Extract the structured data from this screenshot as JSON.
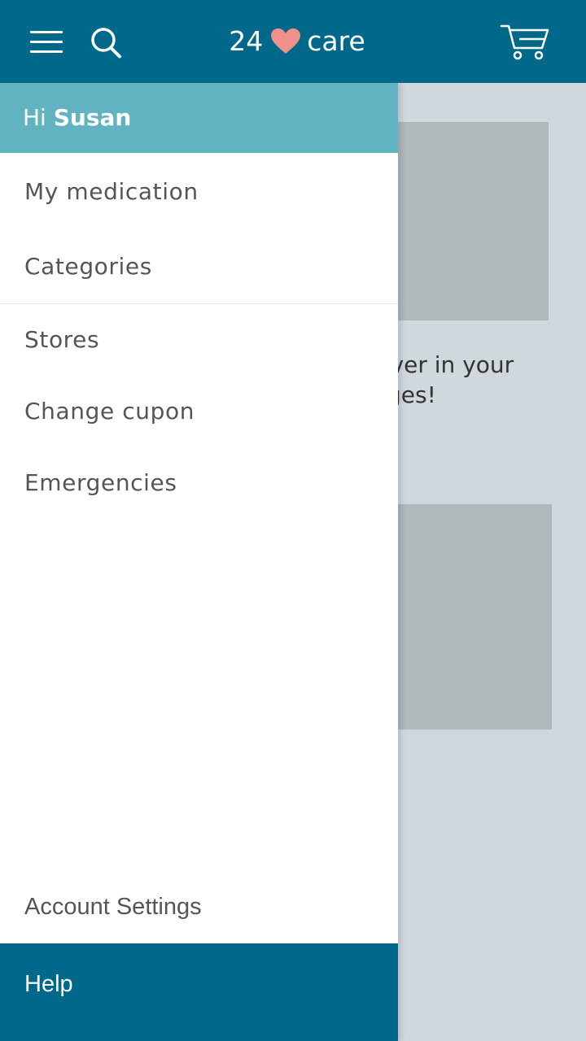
{
  "app": {
    "logo_number": "24",
    "logo_word": "care",
    "logo_heart_color": "#f0908a"
  },
  "colors": {
    "app_bar": "#00688b",
    "drawer_header": "#61b3c2",
    "help_bar": "#00688b",
    "background": "#cfd8dc"
  },
  "toolbar": {
    "menu_icon": "hamburger-menu-icon",
    "search_icon": "search-icon",
    "cart_icon": "shopping-cart-icon"
  },
  "drawer": {
    "greeting": "Hi",
    "user_name": "Susan",
    "items": [
      {
        "label": "My medication"
      },
      {
        "label": "Categories"
      },
      {
        "label": "Stores"
      },
      {
        "label": "Change cupon"
      },
      {
        "label": "Emergencies"
      }
    ],
    "account_settings": "Account Settings",
    "help": "Help"
  },
  "background_content": {
    "text_line_1": "liver in your",
    "text_line_2": "rges!"
  }
}
